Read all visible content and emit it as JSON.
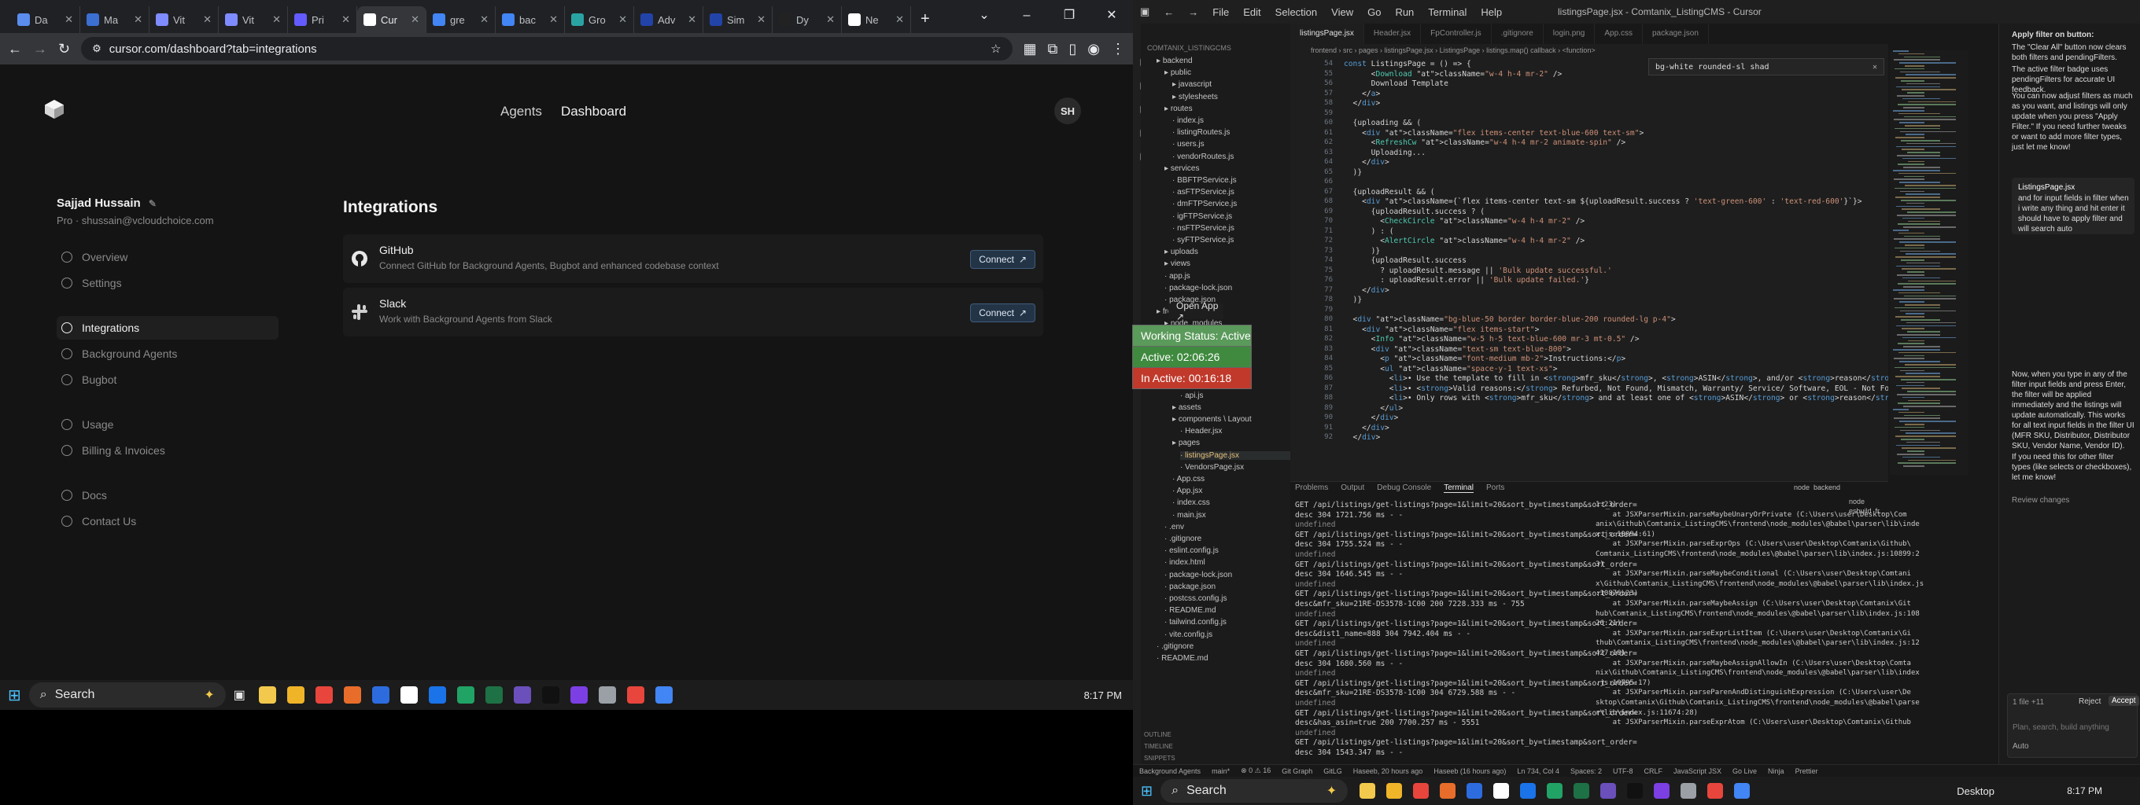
{
  "browser": {
    "tabs": [
      {
        "label": "Da",
        "color": "#5a8dee"
      },
      {
        "label": "Ma",
        "color": "#3b6fd1"
      },
      {
        "label": "Vit",
        "color": "#7f8cff"
      },
      {
        "label": "Vit",
        "color": "#7f8cff"
      },
      {
        "label": "Pri",
        "color": "#635bff"
      },
      {
        "label": "Cur",
        "color": "#ffffff"
      },
      {
        "label": "gre",
        "color": "#4285f4"
      },
      {
        "label": "bac",
        "color": "#4285f4"
      },
      {
        "label": "Gro",
        "color": "#2aa3a3"
      },
      {
        "label": "Adv",
        "color": "#2243a8"
      },
      {
        "label": "Sim",
        "color": "#2243a8"
      },
      {
        "label": "Dy",
        "color": "#222222"
      },
      {
        "label": "Ne",
        "color": "#ffffff"
      }
    ],
    "new_tab_label": "+",
    "window_controls": [
      "⌄",
      "–",
      "❐",
      "✕"
    ],
    "url": "cursor.com/dashboard?tab=integrations"
  },
  "dashboard": {
    "nav": [
      "Agents",
      "Dashboard"
    ],
    "avatar": "SH",
    "user_name": "Sajjad Hussain",
    "user_plan": "Pro · shussain@vcloudchoice.com",
    "sidebar_groups": [
      [
        "Overview",
        "Settings"
      ],
      [
        "Integrations",
        "Background Agents",
        "Bugbot"
      ],
      [
        "Usage",
        "Billing & Invoices"
      ],
      [
        "Docs",
        "Contact Us"
      ]
    ],
    "active_item": "Integrations",
    "title": "Integrations",
    "integrations": [
      {
        "name": "GitHub",
        "desc": "Connect GitHub for Background Agents, Bugbot and enhanced codebase context",
        "button": "Connect"
      },
      {
        "name": "Slack",
        "desc": "Work with Background Agents from Slack",
        "button": "Connect"
      }
    ]
  },
  "taskbar_left": {
    "search": "Search",
    "time": "8:17 PM",
    "icons": [
      "#f2c94c",
      "#f0b429",
      "#e8453c",
      "#e86d2a",
      "#2d6cdf",
      "#ffffff",
      "#1a73e8",
      "#21a366",
      "#1e7145",
      "#6b4fbb",
      "#111111",
      "#7b3fe4",
      "#9aa0a6",
      "#e8453c",
      "#4285f4"
    ]
  },
  "taskbar_right": {
    "search": "Search",
    "desktop": "Desktop",
    "time": "8:17 PM"
  },
  "ide": {
    "title": "listingsPage.jsx - Comtanix_ListingCMS - Cursor",
    "menus": [
      "File",
      "Edit",
      "Selection",
      "View",
      "Go",
      "Run",
      "Terminal",
      "Help"
    ],
    "editor_tabs": [
      "listingsPage.jsx",
      "Header.jsx",
      "FpController.js",
      ".gitignore",
      "login.png",
      "App.css",
      "package.json"
    ],
    "breadcrumb": "frontend › src › pages › listingsPage.jsx › ListingsPage › listings.map() callback › <function>",
    "explorer_title": "COMTANIX_LISTINGCMS",
    "explorer": [
      "backend",
      "public",
      "javascript",
      "stylesheets",
      "routes",
      "index.js",
      "listingRoutes.js",
      "users.js",
      "vendorRoutes.js",
      "services",
      "BBFTPService.js",
      "asFTPService.js",
      "dmFTPService.js",
      "igFTPService.js",
      "nsFTPService.js",
      "syFTPService.js",
      "uploads",
      "views",
      "app.js",
      "package-lock.json",
      "package.json",
      "frontend",
      "node_modules",
      "public",
      "logo.png",
      "vite.svg",
      "src",
      "api",
      "api.js",
      "assets",
      "components \\ Layout",
      "Header.jsx",
      "pages",
      "listingsPage.jsx",
      "VendorsPage.jsx",
      "App.css",
      "App.jsx",
      "index.css",
      "main.jsx",
      ".env",
      ".gitignore",
      "eslint.config.js",
      "index.html",
      "package-lock.json",
      "package.json",
      "postcss.config.js",
      "README.md",
      "tailwind.config.js",
      "vite.config.js",
      ".gitignore",
      "README.md"
    ],
    "outline_items": [
      "OUTLINE",
      "TIMELINE",
      "SNIPPETS"
    ],
    "overlays": [
      {
        "label": "Open App ↗",
        "bg": "#1e1e1e",
        "fg": "#e0e0e0"
      },
      {
        "label": "Working Status: Active",
        "bg": "#5a9a5a",
        "fg": "#ffffff"
      },
      {
        "label": "Active: 02:06:26",
        "bg": "#3f8a3f",
        "fg": "#ffffff"
      },
      {
        "label": "In Active: 00:16:18",
        "bg": "#c0392b",
        "fg": "#ffffff"
      }
    ],
    "code": [
      {
        "n": "54",
        "t": "const ListingsPage = () => {"
      },
      {
        "n": "55",
        "t": "      <Download className=\"w-4 h-4 mr-2\" />"
      },
      {
        "n": "56",
        "t": "      Download Template"
      },
      {
        "n": "57",
        "t": "    </a>"
      },
      {
        "n": "58",
        "t": "  </div>"
      },
      {
        "n": "59",
        "t": ""
      },
      {
        "n": "60",
        "t": "  {uploading && ("
      },
      {
        "n": "61",
        "t": "    <div className=\"flex items-center text-blue-600 text-sm\">"
      },
      {
        "n": "62",
        "t": "      <RefreshCw className=\"w-4 h-4 mr-2 animate-spin\" />"
      },
      {
        "n": "63",
        "t": "      Uploading..."
      },
      {
        "n": "64",
        "t": "    </div>"
      },
      {
        "n": "65",
        "t": "  )}"
      },
      {
        "n": "66",
        "t": ""
      },
      {
        "n": "67",
        "t": "  {uploadResult && ("
      },
      {
        "n": "68",
        "t": "    <div className={`flex items-center text-sm ${uploadResult.success ? 'text-green-600' : 'text-red-600'}`}>"
      },
      {
        "n": "69",
        "t": "      {uploadResult.success ? ("
      },
      {
        "n": "70",
        "t": "        <CheckCircle className=\"w-4 h-4 mr-2\" />"
      },
      {
        "n": "71",
        "t": "      ) : ("
      },
      {
        "n": "72",
        "t": "        <AlertCircle className=\"w-4 h-4 mr-2\" />"
      },
      {
        "n": "73",
        "t": "      )}"
      },
      {
        "n": "74",
        "t": "      {uploadResult.success"
      },
      {
        "n": "75",
        "t": "        ? uploadResult.message || 'Bulk update successful.'"
      },
      {
        "n": "76",
        "t": "        : uploadResult.error || 'Bulk update failed.'}"
      },
      {
        "n": "77",
        "t": "    </div>"
      },
      {
        "n": "78",
        "t": "  )}"
      },
      {
        "n": "79",
        "t": ""
      },
      {
        "n": "80",
        "t": "  <div className=\"bg-blue-50 border border-blue-200 rounded-lg p-4\">"
      },
      {
        "n": "81",
        "t": "    <div className=\"flex items-start\">"
      },
      {
        "n": "82",
        "t": "      <Info className=\"w-5 h-5 text-blue-600 mr-3 mt-0.5\" />"
      },
      {
        "n": "83",
        "t": "      <div className=\"text-sm text-blue-800\">"
      },
      {
        "n": "84",
        "t": "        <p className=\"font-medium mb-2\">Instructions:</p>"
      },
      {
        "n": "85",
        "t": "        <ul className=\"space-y-1 text-xs\">"
      },
      {
        "n": "86",
        "t": "          <li>• Use the template to fill in <strong>mfr_sku</strong>, <strong>ASIN</strong>, and/or <strong>reason</strong>"
      },
      {
        "n": "87",
        "t": "          <li>• <strong>Valid reasons:</strong> Refurbed, Not Found, Mismatch, Warranty/ Service/ Software, EOL - Not Fou"
      },
      {
        "n": "88",
        "t": "          <li>• Only rows with <strong>mfr_sku</strong> and at least one of <strong>ASIN</strong> or <strong>reason</strong>"
      },
      {
        "n": "89",
        "t": "        </ul>"
      },
      {
        "n": "90",
        "t": "      </div>"
      },
      {
        "n": "91",
        "t": "    </div>"
      },
      {
        "n": "92",
        "t": "  </div>"
      }
    ],
    "find_widget": "bg-white rounded-sl shad",
    "panel_tabs": [
      "Problems",
      "Output",
      "Debug Console",
      "Terminal",
      "Ports"
    ],
    "terminal_left": [
      "GET /api/listings/get-listings?page=1&limit=20&sort_by=timestamp&sort_order=",
      "desc 304 1721.756 ms - -",
      "undefined",
      "GET /api/listings/get-listings?page=1&limit=20&sort_by=timestamp&sort_order=",
      "desc 304 1755.524 ms - -",
      "undefined",
      "GET /api/listings/get-listings?page=1&limit=20&sort_by=timestamp&sort_order=",
      "desc 304 1646.545 ms - -",
      "undefined",
      "GET /api/listings/get-listings?page=1&limit=20&sort_by=timestamp&sort_order=",
      "desc&mfr_sku=21RE-DS3578-1C00 200 7228.333 ms - 755",
      "undefined",
      "GET /api/listings/get-listings?page=1&limit=20&sort_by=timestamp&sort_order=",
      "desc&dist1_name=888 304 7942.404 ms - -",
      "undefined",
      "GET /api/listings/get-listings?page=1&limit=20&sort_by=timestamp&sort_order=",
      "desc 304 1680.560 ms - -",
      "undefined",
      "GET /api/listings/get-listings?page=1&limit=20&sort_by=timestamp&sort_order=",
      "desc&mfr_sku=21RE-DS3578-1C00 304 6729.588 ms - -",
      "undefined",
      "GET /api/listings/get-listings?page=1&limit=20&sort_by=timestamp&sort_order=",
      "desc&has_asin=true 200 7700.257 ms - 5551",
      "undefined",
      "GET /api/listings/get-listings?page=1&limit=20&sort_by=timestamp&sort_order=",
      "desc 304 1543.347 ms - -"
    ],
    "terminal_right": [
      "1:23)",
      "    at JSXParserMixin.parseMaybeUnaryOrPrivate (C:\\Users\\user\\Desktop\\Com",
      "anix\\Github\\Comtanix_ListingCMS\\frontend\\node_modules\\@babel\\parser\\lib\\inde",
      "x.js:10894:61)",
      "    at JSXParserMixin.parseExprOps (C:\\Users\\user\\Desktop\\Comtanix\\Github\\",
      "Comtanix_ListingCMS\\frontend\\node_modules\\@babel\\parser\\lib\\index.js:10899:2",
      "3)",
      "    at JSXParserMixin.parseMaybeConditional (C:\\Users\\user\\Desktop\\Comtani",
      "x\\Github\\Comtanix_ListingCMS\\frontend\\node_modules\\@babel\\parser\\lib\\index.js",
      ":10876:23)",
      "    at JSXParserMixin.parseMaybeAssign (C:\\Users\\user\\Desktop\\Comtanix\\Git",
      "hub\\Comtanix_ListingCMS\\frontend\\node_modules\\@babel\\parser\\lib\\index.js:108",
      "26:21)",
      "    at JSXParserMixin.parseExprListItem (C:\\Users\\user\\Desktop\\Comtanix\\Gi",
      "thub\\Comtanix_ListingCMS\\frontend\\node_modules\\@babel\\parser\\lib\\index.js:12",
      "427:18)",
      "    at JSXParserMixin.parseMaybeAssignAllowIn (C:\\Users\\user\\Desktop\\Comta",
      "nix\\Github\\Comtanix_ListingCMS\\frontend\\node_modules\\@babel\\parser\\lib\\index",
      ".js:10795:17)",
      "    at JSXParserMixin.parseParenAndDistinguishExpression (C:\\Users\\user\\De",
      "sktop\\Comtanix\\Github\\Comtanix_ListingCMS\\frontend\\node_modules\\@babel\\parse",
      "r\\lib\\index.js:11674:28)",
      "    at JSXParserMixin.parseExprAtom (C:\\Users\\user\\Desktop\\Comtanix\\Github"
    ],
    "terminal_sessions": [
      "node  backend",
      "node",
      "esbuild  fr..."
    ],
    "status_items": [
      "Background Agents",
      "main*",
      "⊗ 0 ⚠ 16",
      "Git Graph",
      "GitLG",
      "Haseeb, 20 hours ago",
      "Haseeb (16 hours ago)",
      "Ln 734, Col 4",
      "Spaces: 2",
      "UTF-8",
      "CRLF",
      "JavaScript JSX",
      "Go Live",
      "Ninja",
      "Prettier"
    ],
    "chat": {
      "heading": "Apply filter on button:",
      "paras": [
        "The \"Clear All\" button now clears both filters and pendingFilters.",
        "The active filter badge uses pendingFilters for accurate UI feedback.",
        "You can now adjust filters as much as you want, and listings will only update when you press \"Apply Filter.\" If you need further tweaks or want to add more filter types, just let me know!",
        "and for input fields in filter when i write any thing and hit enter it should have to apply filter and will search auto",
        "Now, when you type in any of the filter input fields and press Enter, the filter will be applied immediately and the listings will update automatically. This works for all text input fields in the filter UI (MFR SKU, Distributor, Distributor SKU, Vendor Name, Vendor ID).",
        "If you need this for other filter types (like selects or checkboxes), let me know!"
      ],
      "file_chip": "ListingsPage.jsx",
      "input_placeholder": "Plan, search, build anything",
      "mode": "Auto",
      "review": "Review changes",
      "reject": "Reject",
      "accept": "Accept",
      "diff_count": "1 file +11"
    }
  }
}
